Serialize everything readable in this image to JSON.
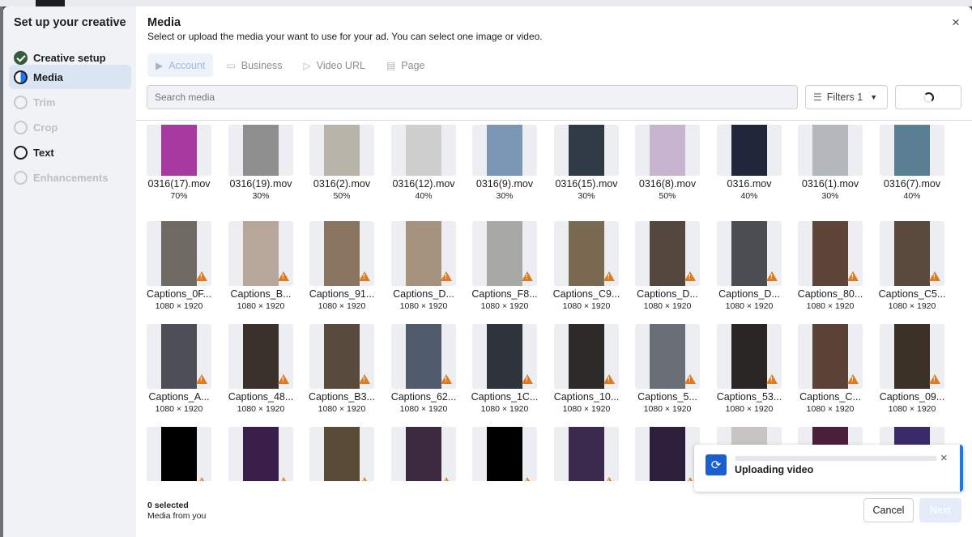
{
  "sidebar": {
    "title": "Set up your creative",
    "steps": [
      {
        "label": "Creative setup",
        "state": "done"
      },
      {
        "label": "Media",
        "state": "active"
      },
      {
        "label": "Trim",
        "state": "pending"
      },
      {
        "label": "Crop",
        "state": "pending"
      },
      {
        "label": "Text",
        "state": "dark"
      },
      {
        "label": "Enhancements",
        "state": "pending"
      }
    ]
  },
  "header": {
    "title": "Media",
    "subtitle": "Select or upload the media your want to use for your ad. You can select one image or video.",
    "close_icon": "×"
  },
  "tabs": [
    {
      "label": "Account",
      "icon": "play-icon"
    },
    {
      "label": "Business",
      "icon": "briefcase-icon"
    },
    {
      "label": "Video URL",
      "icon": "link-video-icon"
    },
    {
      "label": "Page",
      "icon": "page-icon"
    }
  ],
  "search": {
    "placeholder": "Search media"
  },
  "filters": {
    "label": "Filters 1"
  },
  "media_rows": [
    [
      {
        "name": "0316(17).mov",
        "meta": "70%",
        "color": "#a63aa0",
        "warn": false
      },
      {
        "name": "0316(19).mov",
        "meta": "30%",
        "color": "#8e8f8e",
        "warn": false
      },
      {
        "name": "0316(2).mov",
        "meta": "50%",
        "color": "#b9b4aa",
        "warn": false
      },
      {
        "name": "0316(12).mov",
        "meta": "40%",
        "color": "#cfcfcf",
        "warn": false
      },
      {
        "name": "0316(9).mov",
        "meta": "30%",
        "color": "#7c97b6",
        "warn": false
      },
      {
        "name": "0316(15).mov",
        "meta": "30%",
        "color": "#2f3a44",
        "warn": false
      },
      {
        "name": "0316(8).mov",
        "meta": "50%",
        "color": "#c6b4cf",
        "warn": false
      },
      {
        "name": "0316.mov",
        "meta": "40%",
        "color": "#20263a",
        "warn": false
      },
      {
        "name": "0316(1).mov",
        "meta": "30%",
        "color": "#b4b8bc",
        "warn": false
      },
      {
        "name": "0316(7).mov",
        "meta": "40%",
        "color": "#5a7f92",
        "warn": false
      }
    ],
    [
      {
        "name": "Captions_0F...",
        "meta": "1080 × 1920",
        "color": "#6f6b63",
        "warn": true
      },
      {
        "name": "Captions_B...",
        "meta": "1080 × 1920",
        "color": "#b7a79a",
        "warn": true
      },
      {
        "name": "Captions_91...",
        "meta": "1080 × 1920",
        "color": "#8a7560",
        "warn": true
      },
      {
        "name": "Captions_D...",
        "meta": "1080 × 1920",
        "color": "#a5937f",
        "warn": true
      },
      {
        "name": "Captions_F8...",
        "meta": "1080 × 1920",
        "color": "#a8a9a6",
        "warn": true
      },
      {
        "name": "Captions_C9...",
        "meta": "1080 × 1920",
        "color": "#7a6a52",
        "warn": true
      },
      {
        "name": "Captions_D...",
        "meta": "1080 × 1920",
        "color": "#54473e",
        "warn": true
      },
      {
        "name": "Captions_D...",
        "meta": "1080 × 1920",
        "color": "#4b4d52",
        "warn": true
      },
      {
        "name": "Captions_80...",
        "meta": "1080 × 1920",
        "color": "#5e4538",
        "warn": true
      },
      {
        "name": "Captions_C5...",
        "meta": "1080 × 1920",
        "color": "#5a4a3e",
        "warn": true
      }
    ],
    [
      {
        "name": "Captions_A...",
        "meta": "1080 × 1920",
        "color": "#4b4e55",
        "warn": true
      },
      {
        "name": "Captions_48...",
        "meta": "1080 × 1920",
        "color": "#3a322a",
        "warn": true
      },
      {
        "name": "Captions_B3...",
        "meta": "1080 × 1920",
        "color": "#594a3e",
        "warn": true
      },
      {
        "name": "Captions_62...",
        "meta": "1080 × 1920",
        "color": "#4f5a6a",
        "warn": true
      },
      {
        "name": "Captions_1C...",
        "meta": "1080 × 1920",
        "color": "#2e333c",
        "warn": true
      },
      {
        "name": "Captions_10...",
        "meta": "1080 × 1920",
        "color": "#2b2a28",
        "warn": true
      },
      {
        "name": "Captions_5...",
        "meta": "1080 × 1920",
        "color": "#6a6e76",
        "warn": true
      },
      {
        "name": "Captions_53...",
        "meta": "1080 × 1920",
        "color": "#2a2624",
        "warn": true
      },
      {
        "name": "Captions_C...",
        "meta": "1080 × 1920",
        "color": "#5a4334",
        "warn": true
      },
      {
        "name": "Captions_09...",
        "meta": "1080 × 1920",
        "color": "#3b3127",
        "warn": true
      }
    ],
    [
      {
        "name": "",
        "meta": "",
        "color": "#000000",
        "warn": true
      },
      {
        "name": "",
        "meta": "",
        "color": "#3a1f4a",
        "warn": true
      },
      {
        "name": "",
        "meta": "",
        "color": "#5a4a38",
        "warn": true
      },
      {
        "name": "",
        "meta": "",
        "color": "#3b2a3e",
        "warn": true
      },
      {
        "name": "",
        "meta": "",
        "color": "#000000",
        "warn": true
      },
      {
        "name": "",
        "meta": "",
        "color": "#3c2a4e",
        "warn": true
      },
      {
        "name": "",
        "meta": "",
        "color": "#2e1f3c",
        "warn": true
      },
      {
        "name": "",
        "meta": "",
        "color": "#c7c5c2",
        "warn": false
      },
      {
        "name": "",
        "meta": "",
        "color": "#4a1f3a",
        "warn": false
      },
      {
        "name": "",
        "meta": "",
        "color": "#3a2a6a",
        "warn": false
      }
    ]
  ],
  "footer": {
    "selected": "0 selected",
    "source": "Media from you",
    "cancel": "Cancel",
    "next": "Next"
  },
  "toast": {
    "text": "Uploading video",
    "icon": "refresh-icon",
    "close": "×"
  }
}
